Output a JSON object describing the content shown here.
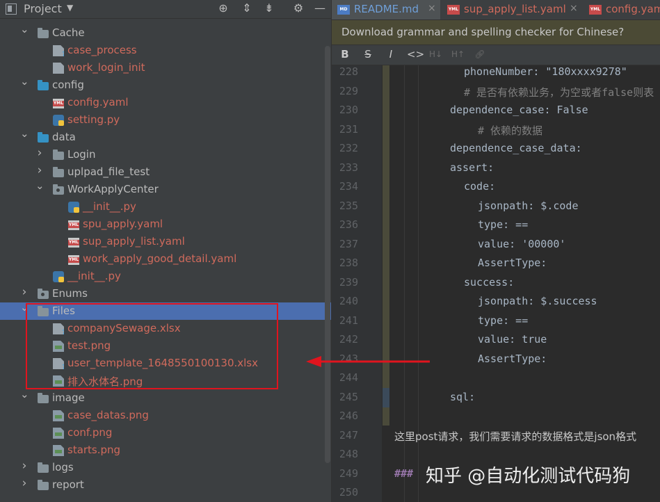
{
  "project_panel": {
    "title": "Project",
    "caret": "▼",
    "toolbar_icons": [
      "target-icon",
      "expand-all-icon",
      "collapse-all-icon",
      "gear-icon",
      "minimize-icon"
    ],
    "tree": [
      {
        "label": "Cache",
        "depth": 1,
        "kind": "folder",
        "expanded": true,
        "color": "white"
      },
      {
        "label": "case_process",
        "depth": 2,
        "kind": "file-unknown",
        "color": "red"
      },
      {
        "label": "work_login_init",
        "depth": 2,
        "kind": "file",
        "color": "red"
      },
      {
        "label": "config",
        "depth": 1,
        "kind": "folder-blue",
        "expanded": true,
        "color": "white"
      },
      {
        "label": "config.yaml",
        "depth": 2,
        "kind": "yaml",
        "color": "red"
      },
      {
        "label": "setting.py",
        "depth": 2,
        "kind": "python",
        "color": "red"
      },
      {
        "label": "data",
        "depth": 1,
        "kind": "folder-blue",
        "expanded": true,
        "color": "white"
      },
      {
        "label": "Login",
        "depth": 2,
        "kind": "folder",
        "expanded": false,
        "color": "white"
      },
      {
        "label": "uplpad_file_test",
        "depth": 2,
        "kind": "folder",
        "expanded": false,
        "color": "white"
      },
      {
        "label": "WorkApplyCenter",
        "depth": 2,
        "kind": "package",
        "expanded": true,
        "color": "white"
      },
      {
        "label": "__init__.py",
        "depth": 3,
        "kind": "python",
        "color": "red"
      },
      {
        "label": "spu_apply.yaml",
        "depth": 3,
        "kind": "yaml",
        "color": "red"
      },
      {
        "label": "sup_apply_list.yaml",
        "depth": 3,
        "kind": "yaml",
        "color": "red"
      },
      {
        "label": "work_apply_good_detail.yaml",
        "depth": 3,
        "kind": "yaml",
        "color": "red"
      },
      {
        "label": "__init__.py",
        "depth": 2,
        "kind": "python",
        "color": "red"
      },
      {
        "label": "Enums",
        "depth": 1,
        "kind": "package",
        "expanded": false,
        "color": "white"
      },
      {
        "label": "Files",
        "depth": 1,
        "kind": "folder",
        "expanded": true,
        "color": "white",
        "selected": true
      },
      {
        "label": "companySewage.xlsx",
        "depth": 2,
        "kind": "file-unknown",
        "color": "red"
      },
      {
        "label": "test.png",
        "depth": 2,
        "kind": "image",
        "color": "red"
      },
      {
        "label": "user_template_1648550100130.xlsx",
        "depth": 2,
        "kind": "file-unknown",
        "color": "red"
      },
      {
        "label": "排入水体名.png",
        "depth": 2,
        "kind": "image",
        "color": "red"
      },
      {
        "label": "image",
        "depth": 1,
        "kind": "folder",
        "expanded": true,
        "color": "white"
      },
      {
        "label": "case_datas.png",
        "depth": 2,
        "kind": "image",
        "color": "red"
      },
      {
        "label": "conf.png",
        "depth": 2,
        "kind": "image",
        "color": "red"
      },
      {
        "label": "starts.png",
        "depth": 2,
        "kind": "image",
        "color": "red"
      },
      {
        "label": "logs",
        "depth": 1,
        "kind": "folder",
        "expanded": false,
        "color": "white"
      },
      {
        "label": "report",
        "depth": 1,
        "kind": "folder",
        "expanded": false,
        "color": "white"
      }
    ]
  },
  "editor": {
    "tabs": [
      {
        "label": "README.md",
        "icon": "markdown-icon",
        "icon_text": "MD",
        "active": true,
        "close": "×"
      },
      {
        "label": "sup_apply_list.yaml",
        "icon": "yaml-icon",
        "icon_text": "YML",
        "active": false,
        "close": "×"
      },
      {
        "label": "config.yam",
        "icon": "yaml-icon",
        "icon_text": "YML",
        "active": false,
        "close": ""
      }
    ],
    "notice": "Download grammar and spelling checker for Chinese?",
    "md_toolbar": [
      "B",
      "S",
      "I",
      "<>",
      "H↓",
      "H↑",
      "link"
    ],
    "lines": [
      {
        "n": "228",
        "text": "phoneNumber: \"180xxxx9278\"",
        "indent": 118,
        "style": "code"
      },
      {
        "n": "229",
        "text": "# 是否有依赖业务，为空或者false则表",
        "indent": 118,
        "style": "comment"
      },
      {
        "n": "230",
        "text": "dependence_case: False",
        "indent": 98,
        "style": "code"
      },
      {
        "n": "231",
        "text": "# 依赖的数据",
        "indent": 138,
        "style": "comment"
      },
      {
        "n": "232",
        "text": "dependence_case_data:",
        "indent": 98,
        "style": "code"
      },
      {
        "n": "233",
        "text": "assert:",
        "indent": 98,
        "style": "code"
      },
      {
        "n": "234",
        "text": "code:",
        "indent": 118,
        "style": "code"
      },
      {
        "n": "235",
        "text": "jsonpath: $.code",
        "indent": 138,
        "style": "code"
      },
      {
        "n": "236",
        "text": "type: ==",
        "indent": 138,
        "style": "code"
      },
      {
        "n": "237",
        "text": "value: '00000'",
        "indent": 138,
        "style": "code"
      },
      {
        "n": "238",
        "text": "AssertType:",
        "indent": 138,
        "style": "code"
      },
      {
        "n": "239",
        "text": "success:",
        "indent": 118,
        "style": "code"
      },
      {
        "n": "240",
        "text": "jsonpath: $.success",
        "indent": 138,
        "style": "code"
      },
      {
        "n": "241",
        "text": "type: ==",
        "indent": 138,
        "style": "code"
      },
      {
        "n": "242",
        "text": "value: true",
        "indent": 138,
        "style": "code"
      },
      {
        "n": "243",
        "text": "AssertType:",
        "indent": 138,
        "style": "code"
      },
      {
        "n": "244",
        "text": "",
        "indent": 98,
        "style": "code"
      },
      {
        "n": "245",
        "text": "sql:",
        "indent": 98,
        "style": "code"
      },
      {
        "n": "246",
        "text": "",
        "indent": 98,
        "style": "code"
      },
      {
        "n": "247",
        "text": "这里post请求，我们需要请求的数据格式是json格式",
        "indent": 18,
        "style": "text"
      },
      {
        "n": "248",
        "text": "",
        "indent": 18,
        "style": "code"
      },
      {
        "n": "249",
        "text": "###",
        "indent": 18,
        "style": "heading"
      },
      {
        "n": "250",
        "text": "",
        "indent": 18,
        "style": "code"
      }
    ]
  },
  "watermark": "知乎 @自动化测试代码狗",
  "annotation_color": "#e0141e"
}
